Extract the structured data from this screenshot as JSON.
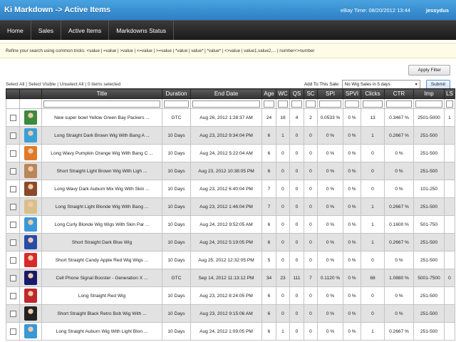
{
  "header": {
    "title": "Ki Markdown -> Active Items",
    "ebay_time": "eBay Time: 08/20/2012 13:44",
    "user": "jessydus"
  },
  "nav": {
    "items": [
      "Home",
      "Sales",
      "Active Items",
      "Markdowns Status"
    ]
  },
  "hint": "Refine your search using common tricks: <value | =value | >value | <=value | >=value | *value | value* | *value* | <>value | value1,value2,... | number<>number",
  "filter": {
    "apply_label": "Apply Filter"
  },
  "selection": {
    "select_all": "Select All",
    "select_visible": "Select Visible",
    "unselect_all": "Unselect All",
    "count": "0 items selected",
    "sep": "|"
  },
  "sale": {
    "label": "Add To This Sale:",
    "selected": "No Wig Sales in 5 days",
    "submit": "Submit"
  },
  "columns": [
    "Title",
    "Duration",
    "End Date",
    "Age",
    "WC",
    "QS",
    "SC",
    "SPI",
    "SPVI",
    "Clicks",
    "CTR",
    "Imp",
    "LS"
  ],
  "rows": [
    {
      "title": "New super bowl Yellow Green Bay Packers ...",
      "duration": "GTC",
      "end_date": "Aug 26, 2012 1:28:37 AM",
      "age": "24",
      "wc": "18",
      "qs": "4",
      "sc": "2",
      "spi": "0.0533 %",
      "spvi": "0 %",
      "clicks": "13",
      "ctr": "0.3467 %",
      "imp": "2501-5000",
      "ls": "1",
      "thumb": "#3c8a3c"
    },
    {
      "title": "Long Straight Dark Brown Wig With Bang A ...",
      "duration": "10 Days",
      "end_date": "Aug 23, 2012 9:34:04 PM",
      "age": "6",
      "wc": "1",
      "qs": "0",
      "sc": "0",
      "spi": "0 %",
      "spvi": "0 %",
      "clicks": "1",
      "ctr": "0.2667 %",
      "imp": "251-500",
      "ls": "",
      "thumb": "#3aa0d8"
    },
    {
      "title": "Long Wavy Pumpkin Orange Wig With Bang C ...",
      "duration": "10 Days",
      "end_date": "Aug 24, 2012 5:22:04 AM",
      "age": "6",
      "wc": "0",
      "qs": "0",
      "sc": "0",
      "spi": "0 %",
      "spvi": "0 %",
      "clicks": "0",
      "ctr": "0 %",
      "imp": "251-500",
      "ls": "",
      "thumb": "#e07a2a"
    },
    {
      "title": "Short Straight Light Brown Wig With Ligh ...",
      "duration": "10 Days",
      "end_date": "Aug 23, 2012 10:38:05 PM",
      "age": "6",
      "wc": "0",
      "qs": "0",
      "sc": "0",
      "spi": "0 %",
      "spvi": "0 %",
      "clicks": "0",
      "ctr": "0 %",
      "imp": "251-500",
      "ls": "",
      "thumb": "#b8865a"
    },
    {
      "title": "Long Wavy Dark Auburn Mix Wig With Skin ...",
      "duration": "10 Days",
      "end_date": "Aug 23, 2012 6:40:04 PM",
      "age": "7",
      "wc": "0",
      "qs": "0",
      "sc": "0",
      "spi": "0 %",
      "spvi": "0 %",
      "clicks": "0",
      "ctr": "0 %",
      "imp": "101-250",
      "ls": "",
      "thumb": "#8a4a2a"
    },
    {
      "title": "Long Straight Light Blonde Wig With Bang ...",
      "duration": "10 Days",
      "end_date": "Aug 23, 2012 1:46:04 PM",
      "age": "7",
      "wc": "0",
      "qs": "0",
      "sc": "0",
      "spi": "0 %",
      "spvi": "0 %",
      "clicks": "1",
      "ctr": "0.2667 %",
      "imp": "251-500",
      "ls": "",
      "thumb": "#d8c08a"
    },
    {
      "title": "Long Curly Blonde Wig Wigs With Skin Par ...",
      "duration": "10 Days",
      "end_date": "Aug 24, 2012 9:52:05 AM",
      "age": "6",
      "wc": "0",
      "qs": "0",
      "sc": "0",
      "spi": "0 %",
      "spvi": "0 %",
      "clicks": "1",
      "ctr": "0.1600 %",
      "imp": "501-750",
      "ls": "",
      "thumb": "#3a98d8"
    },
    {
      "title": "Short Straight Dark Blue Wig",
      "duration": "10 Days",
      "end_date": "Aug 24, 2012 5:19:05 PM",
      "age": "6",
      "wc": "0",
      "qs": "0",
      "sc": "0",
      "spi": "0 %",
      "spvi": "0 %",
      "clicks": "1",
      "ctr": "0.2667 %",
      "imp": "251-500",
      "ls": "",
      "thumb": "#2a4aa8"
    },
    {
      "title": "Short Straight Candy Apple Red Wig Wigs ...",
      "duration": "10 Days",
      "end_date": "Aug 25, 2012 12:32:05 PM",
      "age": "5",
      "wc": "0",
      "qs": "0",
      "sc": "0",
      "spi": "0 %",
      "spvi": "0 %",
      "clicks": "0",
      "ctr": "0 %",
      "imp": "251-500",
      "ls": "",
      "thumb": "#d82a2a"
    },
    {
      "title": "Cell Phone Signal Booster - Generation X ...",
      "duration": "GTC",
      "end_date": "Sep 14, 2012 11:13:12 PM",
      "age": "34",
      "wc": "23",
      "qs": "111",
      "sc": "7",
      "spi": "0.1120 %",
      "spvi": "0 %",
      "clicks": "68",
      "ctr": "1.0880 %",
      "imp": "5001-7500",
      "ls": "0",
      "thumb": "#1a1a6a"
    },
    {
      "title": "Long Straight Red Wig",
      "duration": "10 Days",
      "end_date": "Aug 23, 2012 8:24:05 PM",
      "age": "6",
      "wc": "0",
      "qs": "0",
      "sc": "0",
      "spi": "0 %",
      "spvi": "0 %",
      "clicks": "0",
      "ctr": "0 %",
      "imp": "251-500",
      "ls": "",
      "thumb": "#c0282a"
    },
    {
      "title": "Short Straight Black Retro Bob Wig With ...",
      "duration": "10 Days",
      "end_date": "Aug 23, 2012 9:15:06 AM",
      "age": "6",
      "wc": "0",
      "qs": "0",
      "sc": "0",
      "spi": "0 %",
      "spvi": "0 %",
      "clicks": "0",
      "ctr": "0 %",
      "imp": "251-500",
      "ls": "",
      "thumb": "#222222"
    },
    {
      "title": "Long Straight Auburn Wig With Light Blon ...",
      "duration": "10 Days",
      "end_date": "Aug 24, 2012 1:09:05 PM",
      "age": "6",
      "wc": "1",
      "qs": "0",
      "sc": "0",
      "spi": "0 %",
      "spvi": "0 %",
      "clicks": "1",
      "ctr": "0.2667 %",
      "imp": "251-500",
      "ls": "",
      "thumb": "#3a98d8"
    }
  ]
}
